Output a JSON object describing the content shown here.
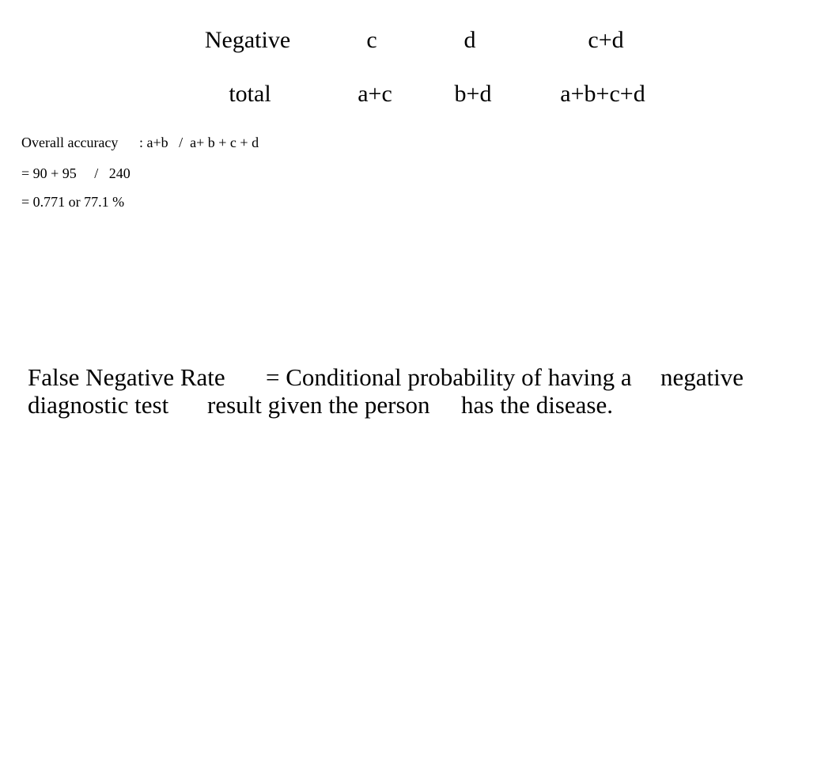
{
  "table": {
    "rows": [
      {
        "label": "Negative",
        "cells": [
          "c",
          "d",
          "c+d"
        ]
      },
      {
        "label": "total",
        "cells": [
          "a+c",
          "b+d",
          "a+b+c+d"
        ]
      }
    ]
  },
  "accuracy": {
    "formula_label": "Overall accuracy",
    "formula": ": a+b   /  a+ b + c + d",
    "substitution": "= 90 + 95     /   240",
    "result": "= 0.771 or 77.1 %"
  },
  "false_negative": {
    "term": "False Negative Rate",
    "definition_line1": "= Conditional probability of having a",
    "definition_word": "negative",
    "line2_part1": "diagnostic test",
    "line2_part2": "result given the person",
    "line2_part3": "has the disease."
  }
}
